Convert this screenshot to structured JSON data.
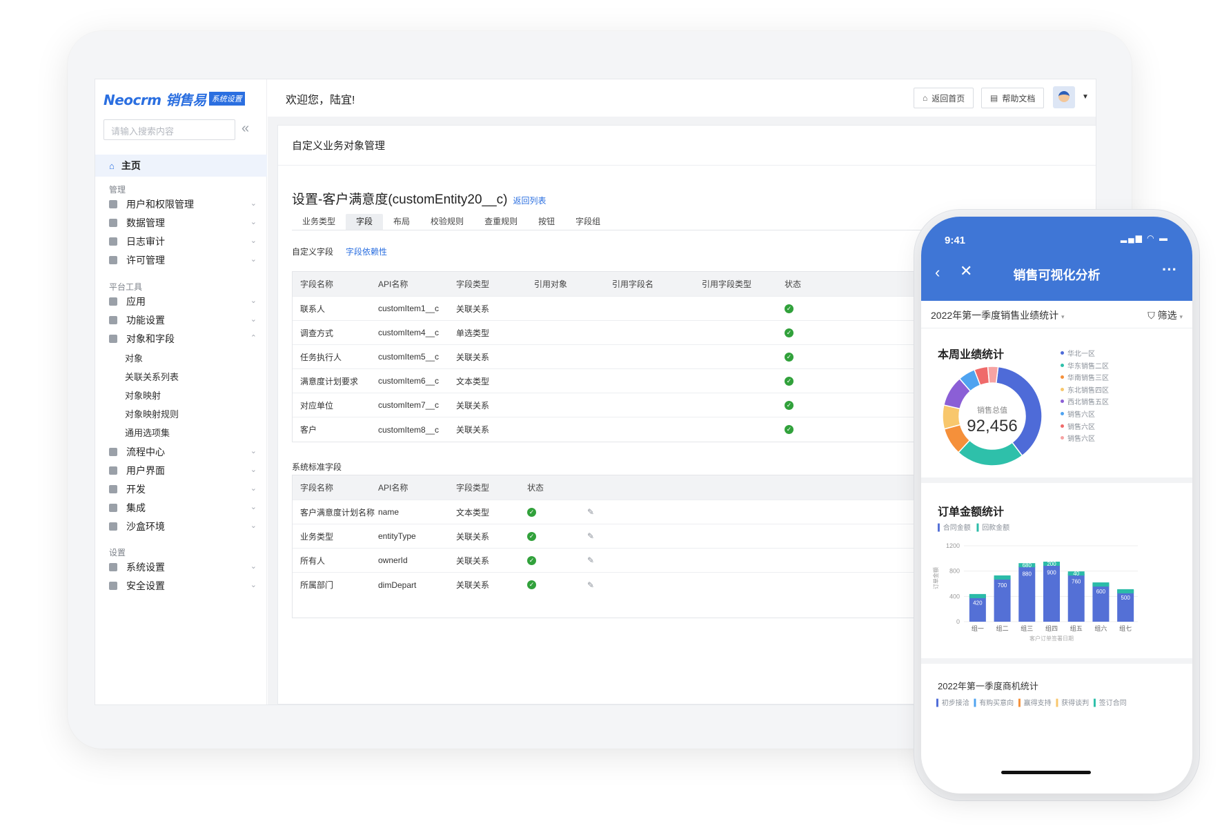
{
  "app": {
    "logo": "Neocrm 销售易",
    "logo_badge": "系统设置",
    "search_placeholder": "请输入搜索内容",
    "welcome": "欢迎您，陆宜!",
    "btn_home": "返回首页",
    "btn_help": "帮助文档"
  },
  "sidebar": {
    "home": "主页",
    "group_manage": "管理",
    "group_tools": "平台工具",
    "group_settings": "设置",
    "items": [
      {
        "label": "用户和权限管理"
      },
      {
        "label": "数据管理"
      },
      {
        "label": "日志审计"
      },
      {
        "label": "许可管理"
      },
      {
        "label": "应用"
      },
      {
        "label": "功能设置"
      },
      {
        "label": "对象和字段"
      },
      {
        "label": "流程中心"
      },
      {
        "label": "用户界面"
      },
      {
        "label": "开发"
      },
      {
        "label": "集成"
      },
      {
        "label": "沙盒环境"
      },
      {
        "label": "系统设置"
      },
      {
        "label": "安全设置"
      }
    ],
    "subitems": [
      "对象",
      "关联关系列表",
      "对象映射",
      "对象映射规则",
      "通用选项集"
    ]
  },
  "main": {
    "card_title": "自定义业务对象管理",
    "heading": "设置-客户满意度(customEntity20__c)",
    "back_link": "返回列表",
    "tabs": [
      "业务类型",
      "字段",
      "布局",
      "校验规则",
      "查重规则",
      "按钮",
      "字段组"
    ],
    "active_tab": "字段",
    "subtab_label": "自定义字段",
    "subtab_link": "字段依赖性",
    "custom_headers": [
      "字段名称",
      "API名称",
      "字段类型",
      "引用对象",
      "引用字段名",
      "引用字段类型",
      "状态"
    ],
    "custom_rows": [
      {
        "name": "联系人",
        "api": "customItem1__c",
        "type": "关联关系"
      },
      {
        "name": "调查方式",
        "api": "customItem4__c",
        "type": "单选类型"
      },
      {
        "name": "任务执行人",
        "api": "customItem5__c",
        "type": "关联关系"
      },
      {
        "name": "满意度计划要求",
        "api": "customItem6__c",
        "type": "文本类型"
      },
      {
        "name": "对应单位",
        "api": "customItem7__c",
        "type": "关联关系"
      },
      {
        "name": "客户",
        "api": "customItem8__c",
        "type": "关联关系"
      }
    ],
    "std_label": "系统标准字段",
    "std_headers": [
      "字段名称",
      "API名称",
      "字段类型",
      "状态"
    ],
    "std_rows": [
      {
        "name": "客户满意度计划名称",
        "api": "name",
        "type": "文本类型"
      },
      {
        "name": "业务类型",
        "api": "entityType",
        "type": "关联关系"
      },
      {
        "name": "所有人",
        "api": "ownerId",
        "type": "关联关系"
      },
      {
        "name": "所属部门",
        "api": "dimDepart",
        "type": "关联关系"
      }
    ]
  },
  "phone": {
    "time": "9:41",
    "title": "销售可视化分析",
    "filter_left": "2022年第一季度销售业绩统计",
    "filter_right": "筛选",
    "sec1": "本周业绩统计",
    "donut_label": "销售总值",
    "donut_value": "92,456",
    "sec2": "订单金额统计",
    "legend2": [
      "合同金额",
      "回款金额"
    ],
    "y_axis_label": "订单金额",
    "x_axis_label": "客户订单签署日期",
    "sec3": "2022年第一季度商机统计",
    "legend3": [
      "初步接洽",
      "有购买意向",
      "赢得支持",
      "获得谈判",
      "签订合同"
    ]
  },
  "colors": {
    "brand": "#2b6fe0",
    "phone_header": "#3f76d6",
    "bar_main": "#5470d6",
    "bar_top": "#2bbba8",
    "ok": "#31a13b"
  },
  "chart_data": [
    {
      "type": "pie",
      "title": "本周业绩统计",
      "center_label": "销售总值",
      "center_value": "92,456",
      "categories": [
        "华北一区",
        "华东销售二区",
        "华南销售三区",
        "东北销售四区",
        "西北销售五区",
        "销售六区",
        "销售六区",
        "销售六区"
      ],
      "values": [
        34,
        20,
        8,
        7,
        9,
        5,
        4,
        3
      ],
      "colors": [
        "#4e6bd8",
        "#2ec0aa",
        "#f5903a",
        "#f8c76c",
        "#8b5fd6",
        "#4fa3f0",
        "#ef6a6a",
        "#f6a3a3"
      ]
    },
    {
      "type": "bar",
      "title": "订单金额统计",
      "ylabel": "订单金额",
      "xlabel": "客户订单签署日期",
      "ylim": [
        0,
        1200
      ],
      "yticks": [
        0,
        400,
        800,
        1200
      ],
      "categories": [
        "组一",
        "组二",
        "组三",
        "组四",
        "组五",
        "组六",
        "组七"
      ],
      "series": [
        {
          "name": "合同金额",
          "values": [
            420,
            700,
            880,
            900,
            760,
            600,
            500
          ]
        },
        {
          "name": "回款金额",
          "values": [
            50,
            90,
            130,
            140,
            100,
            60,
            40
          ]
        }
      ],
      "bar_labels_main": [
        "420",
        "700",
        "880",
        "900",
        "760",
        "600",
        "500"
      ],
      "bar_labels_top": [
        "",
        "",
        "680",
        "200",
        "40",
        "",
        ""
      ]
    }
  ]
}
